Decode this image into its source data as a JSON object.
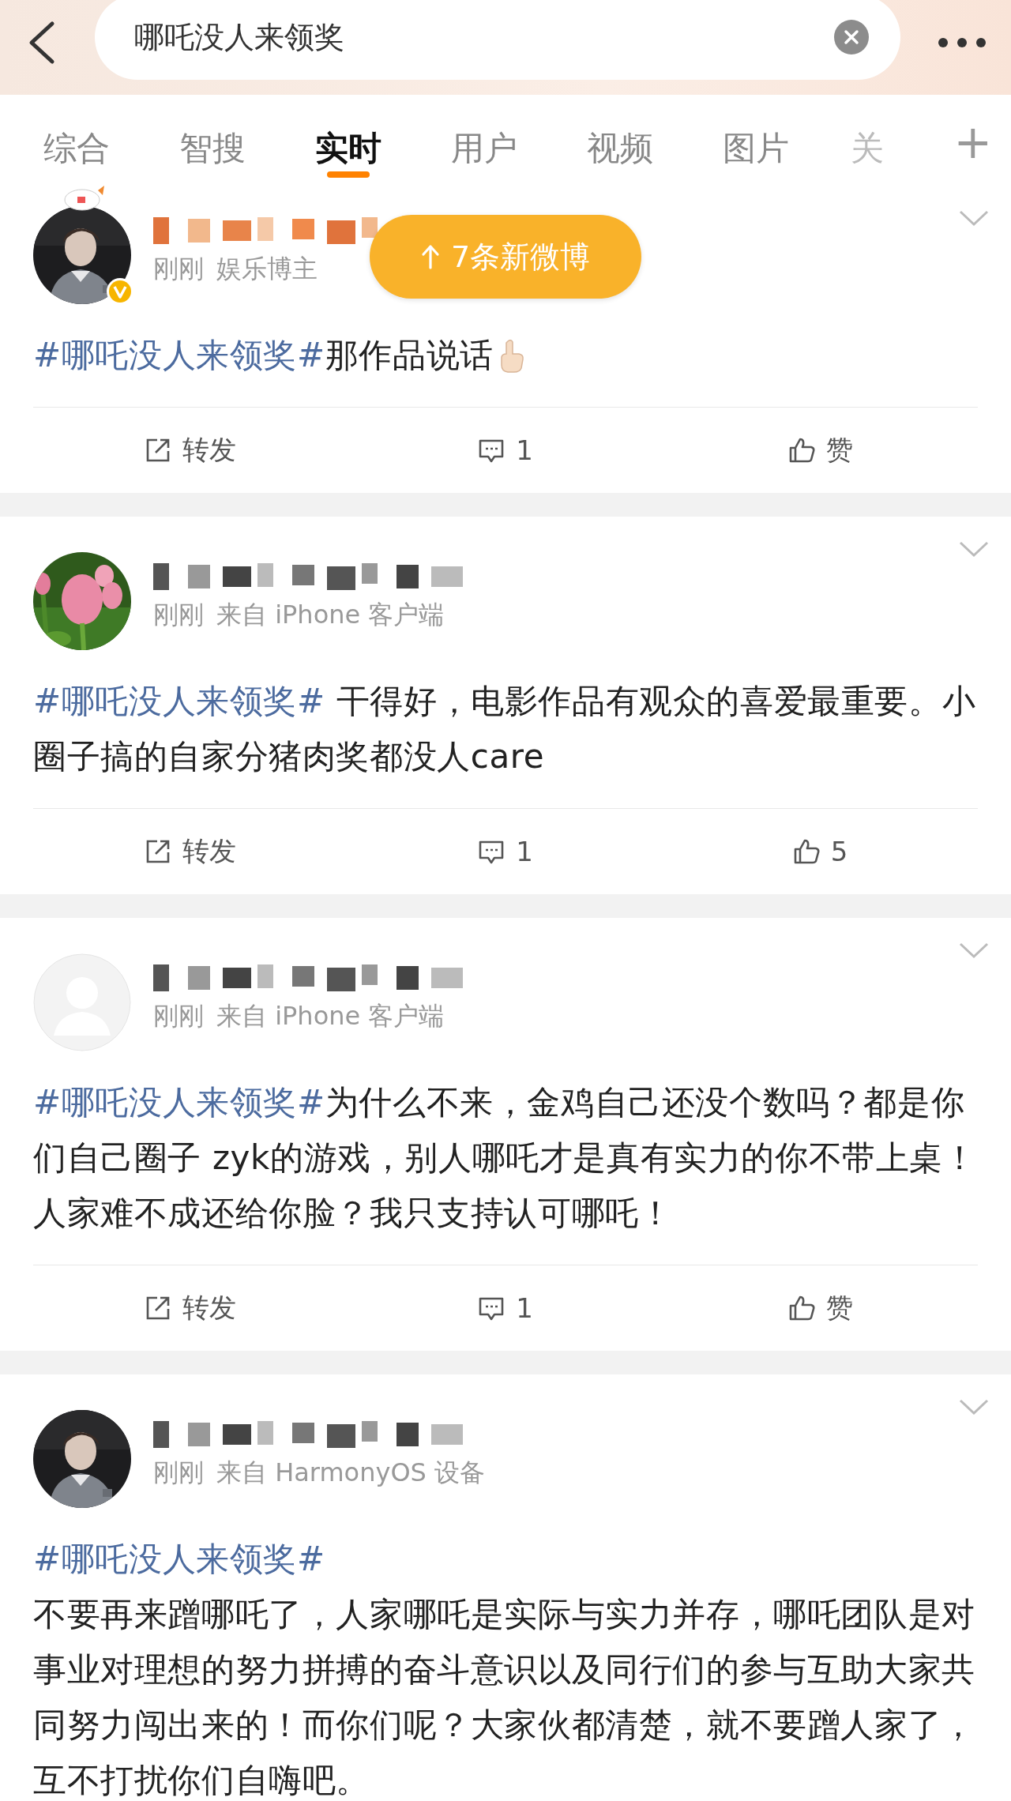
{
  "search": {
    "value": "哪吒没人来领奖"
  },
  "tabs": [
    {
      "label": "综合",
      "selected": false
    },
    {
      "label": "智搜",
      "selected": false
    },
    {
      "label": "实时",
      "selected": true
    },
    {
      "label": "用户",
      "selected": false
    },
    {
      "label": "视频",
      "selected": false
    },
    {
      "label": "图片",
      "selected": false
    },
    {
      "label": "关",
      "selected": false
    }
  ],
  "add_tab": "+",
  "new_posts_toast": "7条新微博",
  "posts": [
    {
      "verified": true,
      "time": "刚刚",
      "source": "娱乐博主",
      "hashtag": "#哪吒没人来领奖#",
      "hashtag_own_line": false,
      "text": "那作品说话",
      "emoji": true,
      "repost": "转发",
      "comment": "1",
      "like": "赞"
    },
    {
      "verified": false,
      "time": "刚刚",
      "source": "来自 iPhone 客户端",
      "hashtag": "#哪吒没人来领奖#",
      "hashtag_own_line": false,
      "text": " 干得好，电影作品有观众的喜爱最重要。小圈子搞的自家分猪肉奖都没人care",
      "emoji": false,
      "repost": "转发",
      "comment": "1",
      "like": "5"
    },
    {
      "avatar": {
        "kind": "icon"
      },
      "verified": false,
      "time": "刚刚",
      "source": "来自 iPhone 客户端",
      "hashtag": "#哪吒没人来领奖#",
      "hashtag_own_line": false,
      "text": "为什么不来，金鸡自己还没个数吗？都是你们自己圈子 zyk的游戏，别人哪吒才是真有实力的你不带上桌！人家难不成还给你脸？我只支持认可哪吒！",
      "emoji": false,
      "repost": "转发",
      "comment": "1",
      "like": "赞"
    },
    {
      "verified": false,
      "time": "刚刚",
      "source": "来自 HarmonyOS 设备",
      "hashtag": "#哪吒没人来领奖#",
      "hashtag_own_line": true,
      "text": "不要再来蹭哪吒了，人家哪吒是实际与实力并存，哪吒团队是对事业对理想的努力拼搏的奋斗意识以及同行们的参与互助大家共同努力闯出来的！而你们呢？大家伙都清楚，就不要蹭人家了，互不打扰你们自嗨吧。",
      "emoji": false
    }
  ]
}
